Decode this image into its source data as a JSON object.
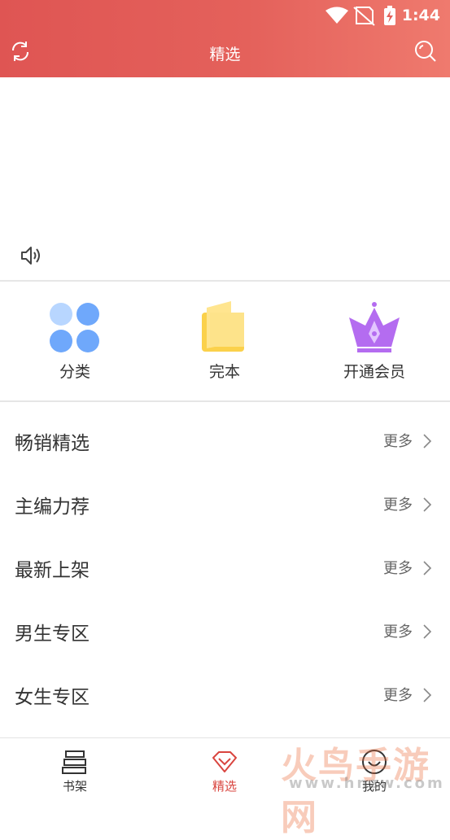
{
  "status_bar": {
    "time": "1:44"
  },
  "header": {
    "title": "精选"
  },
  "quick_actions": [
    {
      "label": "分类",
      "icon": "dots-grid-icon"
    },
    {
      "label": "完本",
      "icon": "book-icon"
    },
    {
      "label": "开通会员",
      "icon": "crown-icon"
    }
  ],
  "sections": [
    {
      "title": "畅销精选",
      "more": "更多"
    },
    {
      "title": "主编力荐",
      "more": "更多"
    },
    {
      "title": "最新上架",
      "more": "更多"
    },
    {
      "title": "男生专区",
      "more": "更多"
    },
    {
      "title": "女生专区",
      "more": "更多"
    }
  ],
  "bottom_nav": [
    {
      "label": "书架",
      "icon": "bookshelf-icon",
      "active": false
    },
    {
      "label": "精选",
      "icon": "diamond-icon",
      "active": true
    },
    {
      "label": "我的",
      "icon": "smile-icon",
      "active": false
    }
  ],
  "watermark": {
    "main": "火鸟手游网",
    "sub": "www.hnzw.com"
  },
  "colors": {
    "accent": "#df5553",
    "active_tab": "#d9453f"
  }
}
